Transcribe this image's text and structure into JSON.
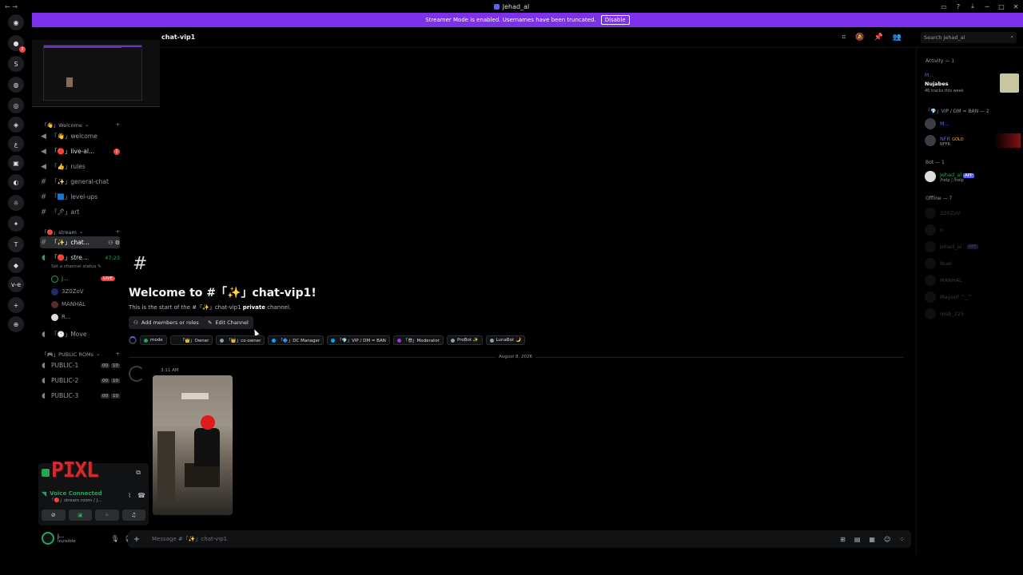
{
  "window": {
    "title": "Jehad_al"
  },
  "banner": {
    "text": "Streamer Mode is enabled. Usernames have been truncated.",
    "disable_label": "Disable"
  },
  "rail": {
    "servers": [
      {
        "glyph": "◉",
        "badge": ""
      },
      {
        "glyph": "●",
        "badge": "2"
      },
      {
        "glyph": "S",
        "badge": ""
      },
      {
        "glyph": "◍",
        "badge": ""
      },
      {
        "glyph": "◎",
        "badge": ""
      },
      {
        "glyph": "◈",
        "badge": ""
      },
      {
        "glyph": "ع",
        "badge": ""
      },
      {
        "glyph": "▣",
        "badge": ""
      },
      {
        "glyph": "◐",
        "badge": ""
      },
      {
        "glyph": "☼",
        "badge": ""
      },
      {
        "glyph": "✦",
        "badge": ""
      },
      {
        "glyph": "T",
        "badge": ""
      },
      {
        "glyph": "◆",
        "badge": ""
      },
      {
        "glyph": "v-e",
        "badge": ""
      },
      {
        "glyph": "+",
        "badge": ""
      },
      {
        "glyph": "⊕",
        "badge": ""
      }
    ]
  },
  "channels": {
    "cat_welcome": "「👋」Welcome",
    "welcome": "「👋」welcome",
    "live": "「🔴」live-al...",
    "live_mentions": "1",
    "rules": "「👍」rules",
    "general": "「✨」general-chat",
    "levelups": "「🟦」level-ups",
    "art": "「🖊」art",
    "cat_stream": "「🔴」stream",
    "chat_active": "「✨」chat...",
    "stream_vc": "「🔴」stre...",
    "stream_timer": "47:23",
    "status_hint": "Set a channel status",
    "move": "「🕐」Move",
    "voice_users": [
      {
        "name": "j...",
        "live": "LIVE"
      },
      {
        "name": "3Z0ZoV",
        "live": ""
      },
      {
        "name": "MANHAL",
        "live": ""
      },
      {
        "name": "R...",
        "live": ""
      }
    ],
    "cat_public": "「🎮」PUBLIC ROMs",
    "public": [
      {
        "name": "PUBLIC-1",
        "a": "00",
        "b": "10"
      },
      {
        "name": "PUBLIC-2",
        "a": "00",
        "b": "10"
      },
      {
        "name": "PUBLIC-3",
        "a": "00",
        "b": "10"
      }
    ]
  },
  "voice": {
    "stream_logo": "PIXL",
    "connected": "Voice Connected",
    "room": "「🔴」stream room / J..."
  },
  "user": {
    "name": "j...",
    "status": "Invisible"
  },
  "header": {
    "channel": "chat-vip1",
    "search_placeholder": "Search Jehad_al"
  },
  "welcome": {
    "title": "Welcome to #「✨」chat-vip1!",
    "sub_pre": "This is the start of the #「✨」chat-vip1 ",
    "sub_bold": "private",
    "sub_post": " channel.",
    "add_members": "Add members or roles",
    "edit_channel": "Edit Channel"
  },
  "roles": [
    {
      "label": "mode",
      "color": "#23a55a"
    },
    {
      "label": "「👑」Owner",
      "color": "#111214"
    },
    {
      "label": "「👑」co owner",
      "color": "#949ba4"
    },
    {
      "label": "「🔷」DC Manager",
      "color": "#00a8fc"
    },
    {
      "label": "「💎」VIP / DM = BAN",
      "color": "#00a8fc"
    },
    {
      "label": "「😎」Moderator",
      "color": "#a335ee"
    },
    {
      "label": "ProBot ✨",
      "color": "#949ba4"
    },
    {
      "label": "LunaBot 🌙",
      "color": "#949ba4"
    }
  ],
  "divider": {
    "date": "August 8, 2026"
  },
  "message": {
    "time": "3:11 AM"
  },
  "composer": {
    "placeholder": "Message #「✨」chat-vip1"
  },
  "members": {
    "activity_head": "Activity — 1",
    "activity": {
      "name": "M...",
      "title": "Nujabes",
      "sub": "46 tracks this week"
    },
    "vip_head": "「💎」VIP / DM = BAN — 2",
    "vip": [
      {
        "name": "M...",
        "sub": "",
        "tag": "",
        "gold": ""
      },
      {
        "name": "NFR",
        "sub": "NFFR",
        "tag": "",
        "gold": "GOLD"
      }
    ],
    "bot_head": "Bot — 1",
    "bot": {
      "name": "Jehad_al",
      "sub": "/help | /help",
      "tag": "APP"
    },
    "offline_head": "Offline — 7",
    "offline": [
      {
        "name": "3Z0ZoV",
        "tag": ""
      },
      {
        "name": "o",
        "tag": ""
      },
      {
        "name": "Jehad_al",
        "tag": "APP"
      },
      {
        "name": "Nuel",
        "tag": ""
      },
      {
        "name": "MANHAL",
        "tag": ""
      },
      {
        "name": "Mayoof ^_^",
        "tag": ""
      },
      {
        "name": "roob_225",
        "tag": ""
      }
    ]
  }
}
